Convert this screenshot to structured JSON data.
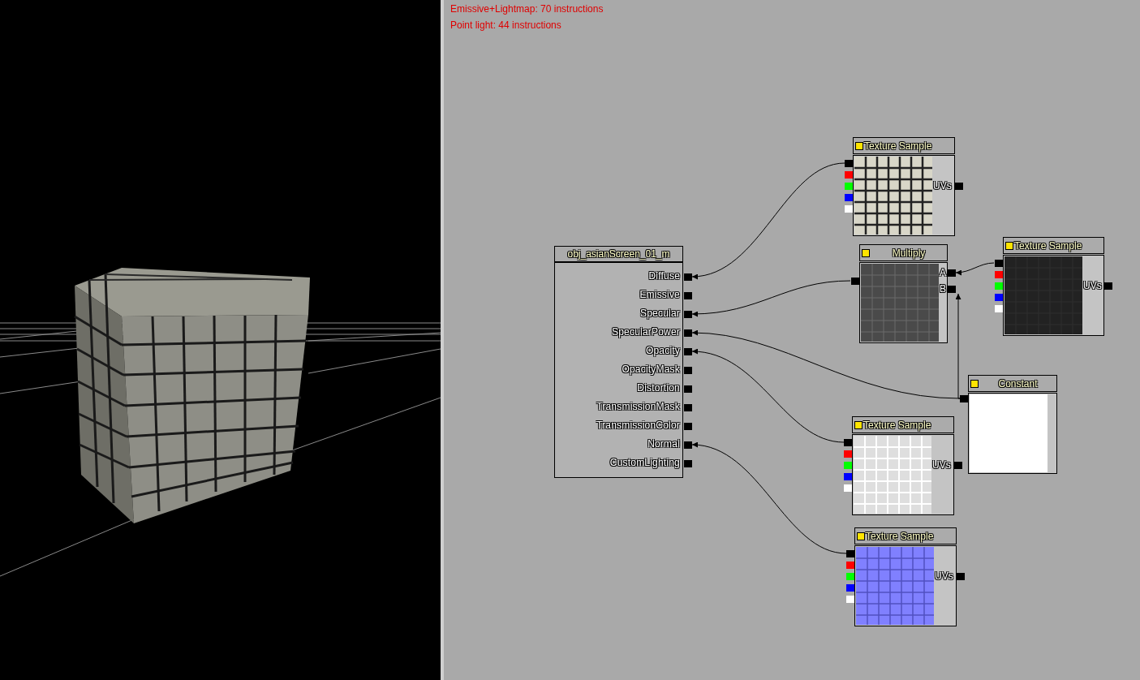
{
  "stats": [
    "Emissive+Lightmap: 70 instructions",
    "Point light: 44 instructions"
  ],
  "material": {
    "title": "obj_asianScreen_01_m",
    "inputs": [
      "Diffuse",
      "Emissive",
      "Specular",
      "SpecularPower",
      "Opacity",
      "OpacityMask",
      "Distortion",
      "TransmissionMask",
      "TransmissionColor",
      "Normal",
      "CustomLighting"
    ]
  },
  "expressions": [
    {
      "kind": "texture",
      "title": "Texture Sample",
      "input": "UVs"
    },
    {
      "kind": "multiply",
      "title": "Multiply",
      "inputs": [
        "A",
        "B"
      ]
    },
    {
      "kind": "texture",
      "title": "Texture Sample",
      "input": "UVs"
    },
    {
      "kind": "constant",
      "title": "Constant"
    },
    {
      "kind": "texture",
      "title": "Texture Sample",
      "input": "UVs"
    },
    {
      "kind": "texture",
      "title": "Texture Sample",
      "input": "UVs"
    }
  ]
}
